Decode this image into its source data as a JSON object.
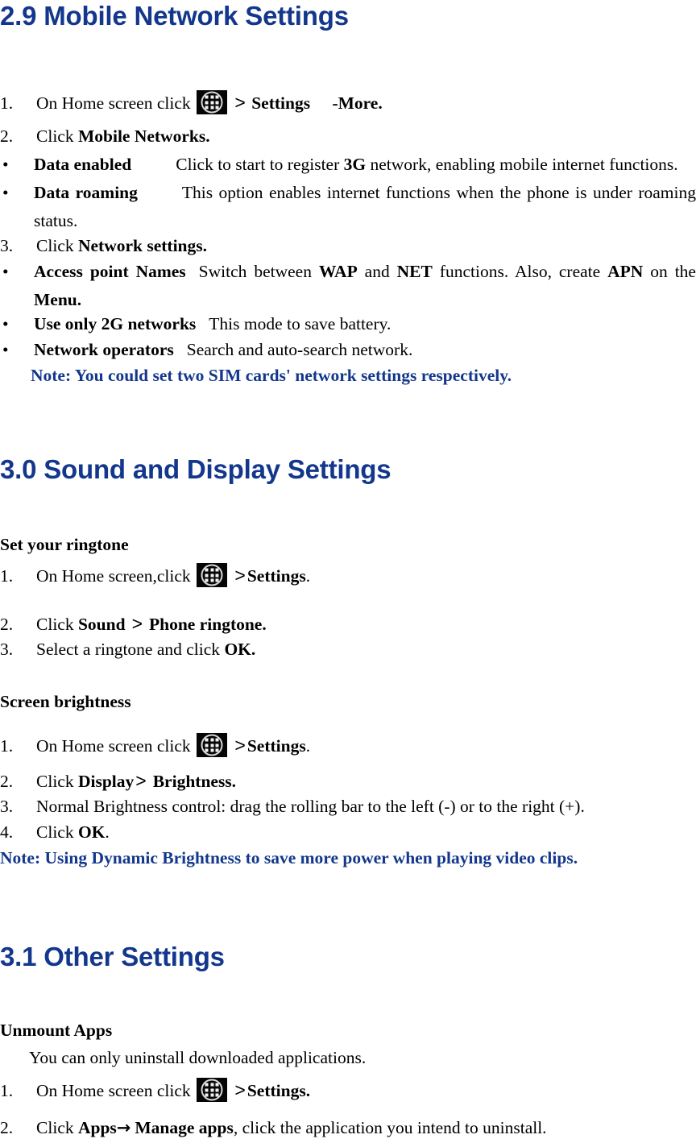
{
  "document": {
    "title": "Mobile Network / Sound and Display / Other Settings",
    "heading_color": "#13378c",
    "body_color": "#000000"
  },
  "icons": {
    "app_drawer": "app-drawer-icon",
    "greater_than": ">",
    "arrow_right": "→",
    "bullet": "•"
  },
  "sections": [
    {
      "id": "mobile-network",
      "heading": "2.9 Mobile Network Settings",
      "steps": [
        {
          "marker": "1.",
          "pre": "On Home screen click",
          "has_icon": true,
          "gt": ">",
          "bold1": "Settings",
          "tail": "-More."
        },
        {
          "marker": "2.",
          "pre": "Click ",
          "bold1": "Mobile Networks."
        }
      ],
      "bullets": [
        {
          "marker": "•",
          "term": "Data enabled",
          "gap": "Click to start to register ",
          "strong": "3G",
          "rest": " network, enabling mobile internet functions."
        },
        {
          "marker": "•",
          "term": "Data roaming",
          "gap": "This option enables internet functions when the phone is under roaming status.",
          "strong": "",
          "rest": ""
        }
      ],
      "step3": {
        "marker": "3.",
        "pre": "Click ",
        "bold1": "Network settings."
      },
      "bullets2": [
        {
          "marker": "•",
          "term": "Access point Names",
          "text_a": "Switch between ",
          "b1": "WAP",
          "text_b": " and ",
          "b2": "NET",
          "text_c": " functions. Also, create ",
          "b3": "APN",
          "text_d": " on the ",
          "b4": "Menu."
        },
        {
          "marker": "•",
          "term": "Use only 2G networks",
          "text_a": "This mode to save battery."
        },
        {
          "marker": "•",
          "term": "Network operators",
          "text_a": "Search and auto-search network."
        }
      ],
      "note": "Note:    You could set two SIM cards' network settings respectively."
    },
    {
      "id": "sound-display",
      "heading": "3.0 Sound and Display Settings",
      "sub1": "Set your ringtone",
      "ringtone_steps": [
        {
          "marker": "1.",
          "pre": "On Home screen,click",
          "has_icon": true,
          "gt": ">",
          "bold1": "Settings",
          "tail": "."
        },
        {
          "marker": "2.",
          "pre": "Click ",
          "bold1": "Sound",
          "gt": ">",
          "bold2": "Phone ringtone."
        },
        {
          "marker": "3.",
          "pre": "Select a ringtone and click ",
          "bold1": "OK."
        }
      ],
      "sub2": "Screen brightness",
      "brightness_steps": [
        {
          "marker": "1.",
          "pre": "On Home screen click",
          "has_icon": true,
          "gt": ">",
          "bold1": "Settings",
          "tail": "."
        },
        {
          "marker": "2.",
          "pre": "Click ",
          "bold1": "Display",
          "gt": ">",
          "bold2": "Brightness."
        },
        {
          "marker": "3.",
          "pre": "Normal Brightness control: drag the rolling bar to the left (-) or to the right (+)."
        },
        {
          "marker": "4.",
          "pre": "Click ",
          "bold1": "OK",
          "tail": "."
        }
      ],
      "note": "Note:    Using Dynamic Brightness to save more power when playing video clips."
    },
    {
      "id": "other-settings",
      "heading": "3.1 Other Settings",
      "sub1": "Unmount Apps",
      "sub1_body": "You can only uninstall downloaded applications.",
      "steps": [
        {
          "marker": "1.",
          "pre": "On Home screen click",
          "has_icon": true,
          "gt": ">",
          "bold1": "Settings."
        },
        {
          "marker": "2.",
          "pre": "Click ",
          "bold1": "Apps",
          "arrow": "→",
          "bold2": "Manage apps",
          "tail": ", click the application you intend to uninstall."
        }
      ]
    }
  ]
}
